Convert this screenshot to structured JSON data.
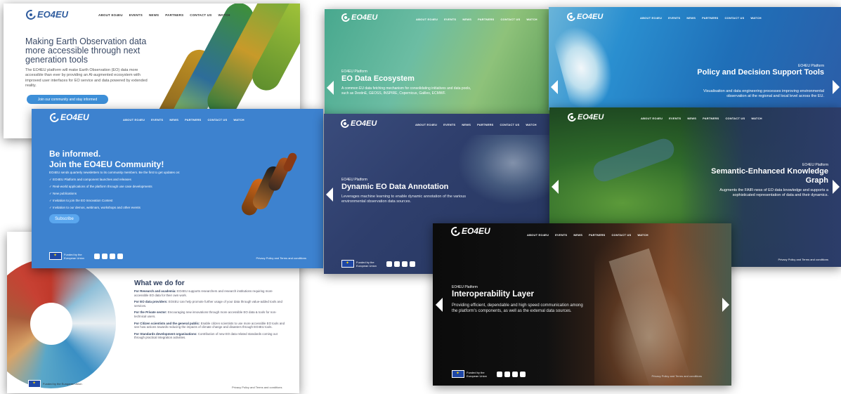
{
  "brand": "EO4EU",
  "nav": [
    "ABOUT EO4EU",
    "EVENTS",
    "NEWS",
    "PARTNERS",
    "CONTACT US",
    "WATCH"
  ],
  "kicker": "EO4EU Platform",
  "funded": "Funded by the European Union",
  "policy": "Privacy Policy and Terms and conditions",
  "home": {
    "headline": "Making Earth Observation data more accessible through next generation tools",
    "body": "The EO4EU platform will make Earth Observation (EO) data more accessible than ever by providing an AI-augmented ecosystem with improved user interfaces for EO service and data powered by extended reality.",
    "cta": "Join our community and stay informed"
  },
  "ecosystem": {
    "title": "EO Data Ecosystem",
    "desc": "A common EU data fetching mechanism for consolidating initiatives and data pools, such as DestinE, GEOSS, INSPIRE, Copernicus, Galileo, ECMWF."
  },
  "policy_slide": {
    "title": "Policy and Decision Support Tools",
    "desc": "Visualisation and data engineering processes improving environmental observation at the regional and local level across the EU."
  },
  "community": {
    "title1": "Be informed.",
    "title2": "Join the EO4EU Community!",
    "intro": "EO4EU sends quarterly newsletters to its community members. Be the first to get updates on:",
    "items": [
      "EO4EU Platform and component launches and releases",
      "Real-world applications of the platform through use case developments",
      "New publications",
      "Invitation to join the EO Innovation Contest",
      "Invitation to our demos, webinars, workshops and other events"
    ],
    "button": "Subscribe"
  },
  "annotation": {
    "title": "Dynamic EO Data Annotation",
    "desc": "Leverages machine learning to enable dynamic annotation of the various environmental observation data sources."
  },
  "semantic": {
    "title": "Semantic-Enhanced Knowledge Graph",
    "desc": "Augments the FAIR-ness of EO data knowledge and supports a sophisticated representation of data and their dynamics."
  },
  "whatwedo": {
    "heading": "What we do for",
    "items": [
      {
        "label": "For Research and academia:",
        "text": "EO4EU supports researchers and research institutions requiring more accessible EO data for their own work."
      },
      {
        "label": "For EO data providers:",
        "text": "EO4EU can help promote further usage of your data through value-added tools and services."
      },
      {
        "label": "For the Private sector:",
        "text": "Encouraging new innovations through more accessible EO data & tools for non-technical users."
      },
      {
        "label": "For Citizen scientists and the general public:",
        "text": "Enable citizen scientists to use more accessible EO tools and see how actions towards reducing the impacts of climate change and disasters through EO4EU tools."
      },
      {
        "label": "For Standards development organisations:",
        "text": "Contribution of new EO data related standards coming out through practical integration activities."
      }
    ]
  },
  "interop": {
    "title": "Interoperability Layer",
    "desc": "Providing efficient, dependable and high speed communication among the platform's components, as well as the external data sources."
  },
  "colors": {
    "primary_blue": "#3d82cf",
    "navy": "#2f3f6d",
    "dark": "#111111",
    "teal": "#5fb69e"
  }
}
